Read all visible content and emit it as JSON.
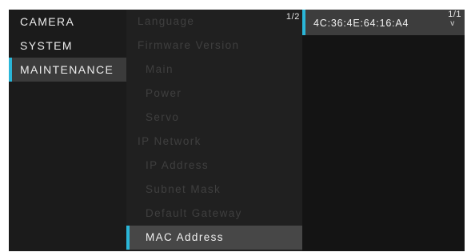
{
  "left_menu": {
    "items": [
      {
        "label": "CAMERA"
      },
      {
        "label": "SYSTEM"
      },
      {
        "label": "MAINTENANCE"
      }
    ]
  },
  "mid_menu": {
    "page_indicator": "1/2",
    "items": [
      {
        "label": "Language"
      },
      {
        "label": "Firmware Version"
      },
      {
        "label": "Main"
      },
      {
        "label": "Power"
      },
      {
        "label": "Servo"
      },
      {
        "label": "IP Network"
      },
      {
        "label": "IP Address"
      },
      {
        "label": "Subnet Mask"
      },
      {
        "label": "Default Gateway"
      },
      {
        "label": "MAC Address"
      }
    ]
  },
  "right_panel": {
    "page_indicator": "1/1",
    "value": "4C:36:4E:64:16:A4",
    "arrow": "v"
  },
  "colors": {
    "accent": "#2ab6d8",
    "background": "#191919",
    "selected_bg": "#474747",
    "dim_text": "#3f3f3f"
  }
}
